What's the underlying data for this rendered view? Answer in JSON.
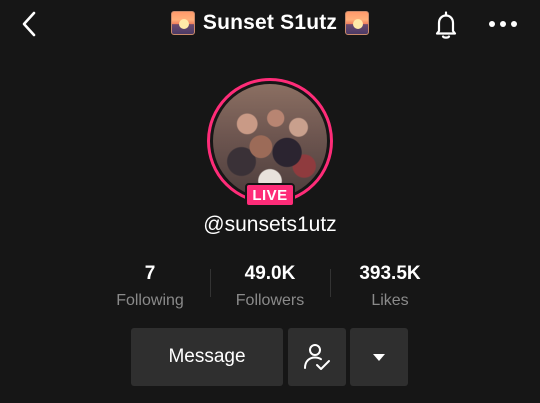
{
  "header": {
    "title": "Sunset S1utz",
    "left_emoji": "sunset-emoji-icon",
    "right_emoji": "sunset-emoji-icon"
  },
  "profile": {
    "username": "@sunsets1utz",
    "live_label": "LIVE",
    "ring_color": "#fe2c78"
  },
  "stats": [
    {
      "value": "7",
      "label": "Following"
    },
    {
      "value": "49.0K",
      "label": "Followers"
    },
    {
      "value": "393.5K",
      "label": "Likes"
    }
  ],
  "actions": {
    "message_label": "Message",
    "follow_icon": "person-check-icon",
    "dropdown_icon": "caret-down-icon"
  },
  "colors": {
    "background": "#161616",
    "accent": "#fe2c78",
    "button_bg": "#2f2f2f",
    "secondary_text": "#8a8a8a"
  }
}
